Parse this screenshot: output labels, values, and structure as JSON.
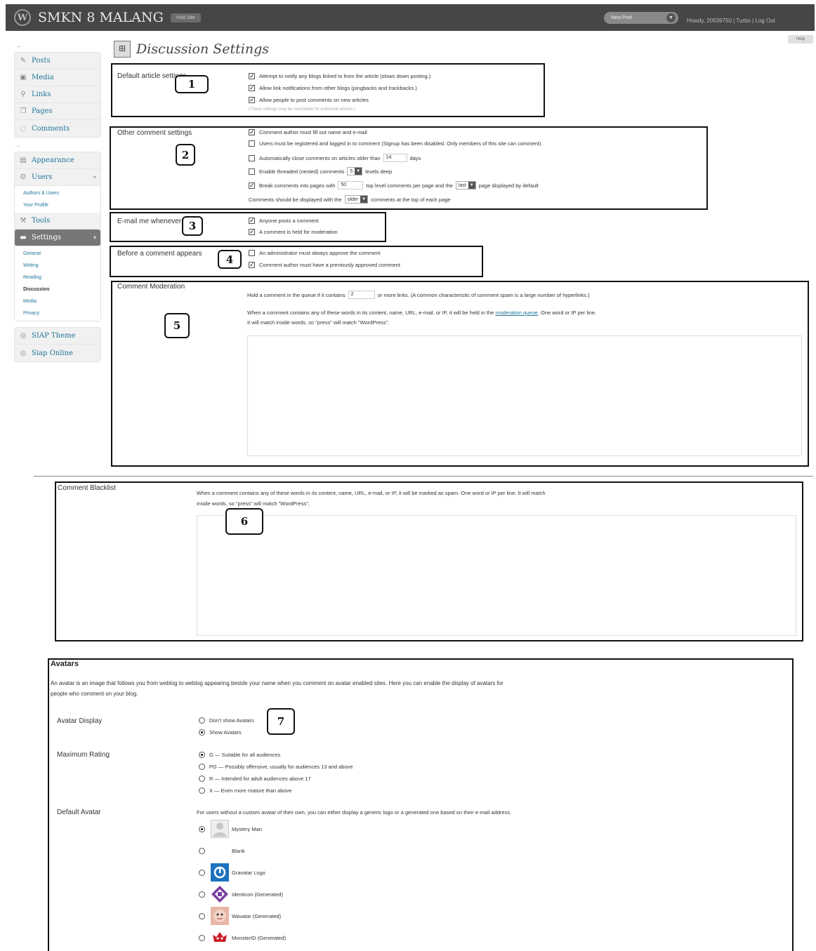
{
  "admin_bar": {
    "site_name": "SMKN 8 MALANG",
    "visit_site": "Visit Site",
    "new_post": "New Post",
    "user_links": "Howdy, 20539750 | Turbo | Log Out"
  },
  "sidebar": {
    "group1": [
      {
        "label": "Posts",
        "icon": "pin-icon"
      },
      {
        "label": "Media",
        "icon": "media-icon"
      },
      {
        "label": "Links",
        "icon": "links-icon"
      },
      {
        "label": "Pages",
        "icon": "pages-icon"
      },
      {
        "label": "Comments",
        "icon": "comments-icon"
      }
    ],
    "group2": [
      {
        "label": "Appearance",
        "icon": "appearance-icon"
      },
      {
        "label": "Users",
        "icon": "users-icon"
      }
    ],
    "users_sub": [
      "Authors & Users",
      "Your Profile"
    ],
    "tools": "Tools",
    "settings": "Settings",
    "settings_sub": [
      "General",
      "Writing",
      "Reading",
      "Discussion",
      "Media",
      "Privacy"
    ],
    "group3": [
      "SIAP Theme",
      "Siap Online"
    ]
  },
  "page": {
    "title": "Discussion Settings",
    "help": "Help"
  },
  "sections": {
    "default_article": {
      "label": "Default article settings",
      "num": "1",
      "options": [
        {
          "text": "Attempt to notify any blogs linked to from the article (slows down posting.)",
          "checked": true
        },
        {
          "text": "Allow link notifications from other blogs (pingbacks and trackbacks.)",
          "checked": true
        },
        {
          "text": "Allow people to post comments on new articles",
          "checked": true
        }
      ],
      "note": "(These settings may be overridden for individual articles.)"
    },
    "other_comment": {
      "label": "Other comment settings",
      "num": "2",
      "opt1": "Comment author must fill out name and e-mail",
      "opt2": "Users must be registered and logged in to comment (Signup has been disabled. Only members of this site can comment)",
      "opt3_pre": "Automatically close comments on articles older than",
      "opt3_val": "14",
      "opt3_post": "days",
      "opt4_pre": "Enable threaded (nested) comments",
      "opt4_val": "5",
      "opt4_post": "levels deep",
      "opt5_pre": "Break comments into pages with",
      "opt5_val": "50",
      "opt5_mid": "top level comments per page and the",
      "opt5_sel": "last",
      "opt5_post": "page displayed by default",
      "opt6_pre": "Comments should be displayed with the",
      "opt6_sel": "older",
      "opt6_post": "comments at the top of each page"
    },
    "email_me": {
      "label": "E-mail me whenever",
      "num": "3",
      "opt1": "Anyone posts a comment",
      "opt2": "A comment is held for moderation"
    },
    "before_appears": {
      "label": "Before a comment appears",
      "num": "4",
      "opt1": "An administrator must always approve the comment",
      "opt2": "Comment author must have a previously approved comment"
    },
    "moderation": {
      "label": "Comment Moderation",
      "num": "5",
      "hold_pre": "Hold a comment in the queue if it contains",
      "hold_val": "2",
      "hold_post": "or more links. (A common characteristic of comment spam is a large number of hyperlinks.)",
      "desc_pre": "When a comment contains any of these words in its content, name, URL, e-mail, or IP, it will be held in the",
      "desc_link": "moderation queue",
      "desc_post": ". One word or IP per line.",
      "desc_line2": "It will match inside words, so \"press\" will match \"WordPress\"."
    },
    "blacklist": {
      "label": "Comment Blacklist",
      "num": "6",
      "desc_line1": "When a comment contains any of these words in its content, name, URL, e-mail, or IP, it will be marked as spam. One word or IP per line. It will match",
      "desc_line2": "inside words, so \"press\" will match \"WordPress\"."
    },
    "avatars": {
      "title": "Avatars",
      "num": "7",
      "intro_line1": "An avatar is an image that follows you from weblog to weblog appearing beside your name when you comment on avatar enabled sites. Here you can enable the display of avatars for",
      "intro_line2": "people who comment on your blog.",
      "display_label": "Avatar Display",
      "display_opt1": "Don't show Avatars",
      "display_opt2": "Show Avatars",
      "rating_label": "Maximum Rating",
      "ratings": [
        "G — Suitable for all audiences",
        "PG — Possibly offensive, usually for audiences 13 and above",
        "R — Intended for adult audiences above 17",
        "X — Even more mature than above"
      ],
      "default_label": "Default Avatar",
      "default_desc": "For users without a custom avatar of their own, you can either display a generic logo or a generated one based on their e-mail address.",
      "defaults": [
        "Mystery Man",
        "Blank",
        "Gravatar Logo",
        "Identicon (Generated)",
        "Wavatar (Generated)",
        "MonsterID (Generated)"
      ]
    }
  },
  "colors": {
    "admin_bar": "#464646",
    "link": "#21759b",
    "annotation_border": "#111111"
  }
}
